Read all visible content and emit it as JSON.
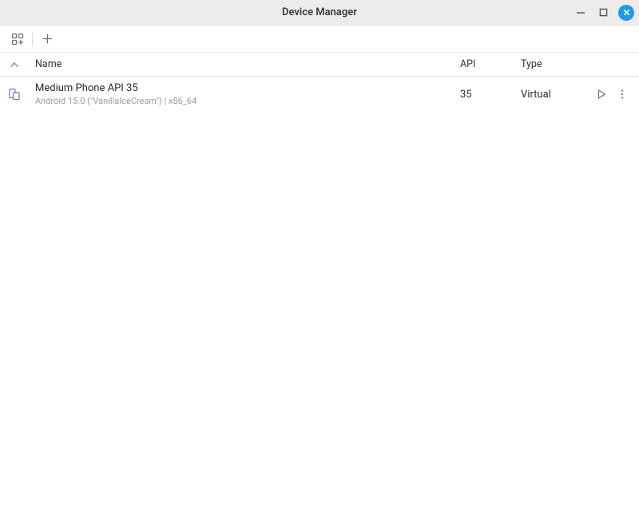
{
  "window": {
    "title": "Device Manager"
  },
  "columns": {
    "name": "Name",
    "api": "API",
    "type": "Type"
  },
  "devices": [
    {
      "name": "Medium Phone API 35",
      "subtitle": "Android 15.0 (\"VanillaIceCream\") | x86_64",
      "api": "35",
      "type": "Virtual"
    }
  ]
}
